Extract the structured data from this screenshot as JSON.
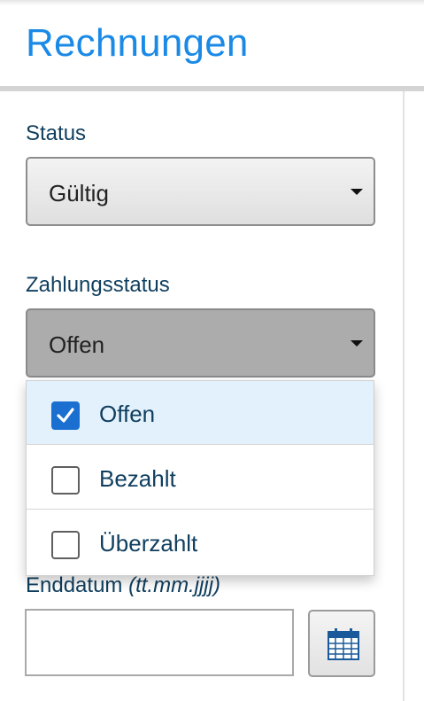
{
  "page": {
    "title": "Rechnungen"
  },
  "status_filter": {
    "label": "Status",
    "selected": "Gültig"
  },
  "payment_filter": {
    "label": "Zahlungsstatus",
    "selected": "Offen",
    "options": [
      {
        "label": "Offen",
        "checked": true
      },
      {
        "label": "Bezahlt",
        "checked": false
      },
      {
        "label": "Überzahlt",
        "checked": false
      }
    ]
  },
  "end_date": {
    "label": "Enddatum",
    "format_hint": "(tt.mm.jjjj)",
    "value": "",
    "calendar_icon": "calendar-icon"
  },
  "colors": {
    "title": "#1a8ae6",
    "label": "#0f3e5e",
    "checkbox_checked": "#1a6fd1",
    "selected_option_bg": "#e3f1fd"
  }
}
